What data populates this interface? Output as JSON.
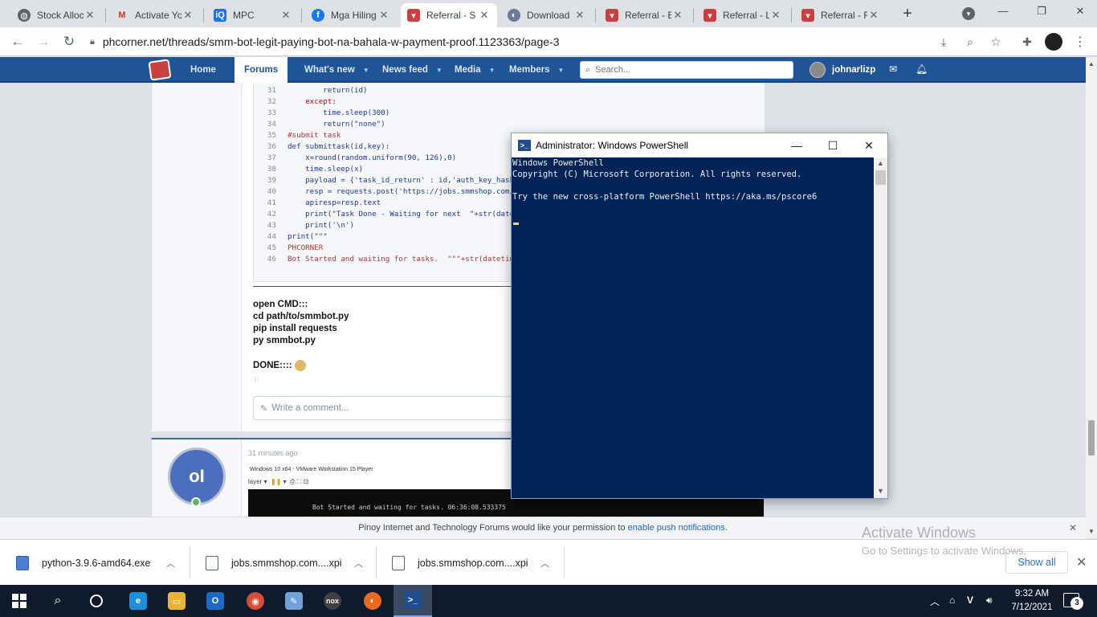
{
  "browser": {
    "tabs": [
      {
        "label": "Stock Alloc",
        "icon": "stock-icon"
      },
      {
        "label": "Activate Yo",
        "icon": "gmail-icon"
      },
      {
        "label": "MPC",
        "icon": "mpc-icon"
      },
      {
        "label": "Mga Hiling",
        "icon": "facebook-icon"
      },
      {
        "label": "Referral - S",
        "icon": "phcorner-icon"
      },
      {
        "label": "Download",
        "icon": "download-site-icon"
      },
      {
        "label": "Referral - E",
        "icon": "phcorner-icon"
      },
      {
        "label": "Referral - L",
        "icon": "phcorner-icon"
      },
      {
        "label": "Referral - F",
        "icon": "phcorner-icon"
      }
    ],
    "active_tab_index": 4,
    "url": "phcorner.net/threads/smm-bot-legit-paying-bot-na-bahala-w-payment-proof.1123363/page-3"
  },
  "site_nav": {
    "items": [
      {
        "label": "Home"
      },
      {
        "label": "Forums"
      },
      {
        "label": "What's new"
      },
      {
        "label": "News feed"
      },
      {
        "label": "Media"
      },
      {
        "label": "Members"
      }
    ],
    "search_placeholder": "Search...",
    "username": "johnarlizp"
  },
  "code": {
    "lines": [
      {
        "n": "31",
        "text": "        return(id)"
      },
      {
        "n": "32",
        "text": "    except:"
      },
      {
        "n": "33",
        "text": "        time.sleep(300)"
      },
      {
        "n": "34",
        "text": "        return(\"none\")"
      },
      {
        "n": "35",
        "text": "#submit task"
      },
      {
        "n": "36",
        "text": "def submittask(id,key):"
      },
      {
        "n": "37",
        "text": "    x=round(random.uniform(90, 126),0)"
      },
      {
        "n": "38",
        "text": "    time.sleep(x)"
      },
      {
        "n": "39",
        "text": "    payload = {'task_id_return' : id,'auth_key_hash'"
      },
      {
        "n": "40",
        "text": "    resp = requests.post('https://jobs.smmshop.com/b"
      },
      {
        "n": "41",
        "text": "    apiresp=resp.text"
      },
      {
        "n": "42",
        "text": "    print(\"Task Done - Waiting for next  \"+str(datet"
      },
      {
        "n": "43",
        "text": "    print('\\n')"
      },
      {
        "n": "44",
        "text": "print(\"\"\""
      },
      {
        "n": "45",
        "text": "PHCORNER"
      },
      {
        "n": "46",
        "text": "Bot Started and waiting for tasks.  \"\"\"+str(datetime"
      }
    ]
  },
  "post": {
    "instructions": [
      "open CMD:::",
      "cd path/to/smmbot.py",
      "pip install requests",
      "py smmbot.py"
    ],
    "done_text": "DONE::::",
    "comment_placeholder": "Write a comment..."
  },
  "post2": {
    "time": "31 minutes ago",
    "vm_title": "Windows 10 x64 - VMware Workstation 15 Player",
    "vm_toolbar": "layer",
    "vm_console_text": "Bot Started and waiting for tasks.  06:36:08.533375"
  },
  "powershell": {
    "title": "Administrator: Windows PowerShell",
    "lines": [
      "Windows PowerShell",
      "Copyright (C) Microsoft Corporation. All rights reserved.",
      "",
      "Try the new cross-platform PowerShell https://aka.ms/pscore6"
    ]
  },
  "notification": {
    "text": "Pinoy Internet and Technology Forums would like your permission to ",
    "link": "enable push notifications."
  },
  "downloads": {
    "items": [
      {
        "name": "python-3.9.6-amd64.exe"
      },
      {
        "name": "jobs.smmshop.com....xpi"
      },
      {
        "name": "jobs.smmshop.com....xpi"
      }
    ],
    "show_all": "Show all"
  },
  "watermark": {
    "line1": "Activate Windows",
    "line2": "Go to Settings to activate Windows."
  },
  "taskbar": {
    "apps": [
      {
        "name": "Edge",
        "color": "#1b8fd8"
      },
      {
        "name": "File Explorer",
        "color": "#e8b432"
      },
      {
        "name": "Outlook",
        "color": "#1c6ac7"
      },
      {
        "name": "Chrome",
        "color": "#dd4b39"
      },
      {
        "name": "Notepad",
        "color": "#6fa2d9"
      },
      {
        "name": "Nox",
        "color": "#3f3f3f"
      },
      {
        "name": "Firefox",
        "color": "#e66a1f"
      },
      {
        "name": "PowerShell",
        "color": "#1f4d8f"
      }
    ],
    "time": "9:32 AM",
    "date": "7/12/2021",
    "notifications_count": "3"
  }
}
